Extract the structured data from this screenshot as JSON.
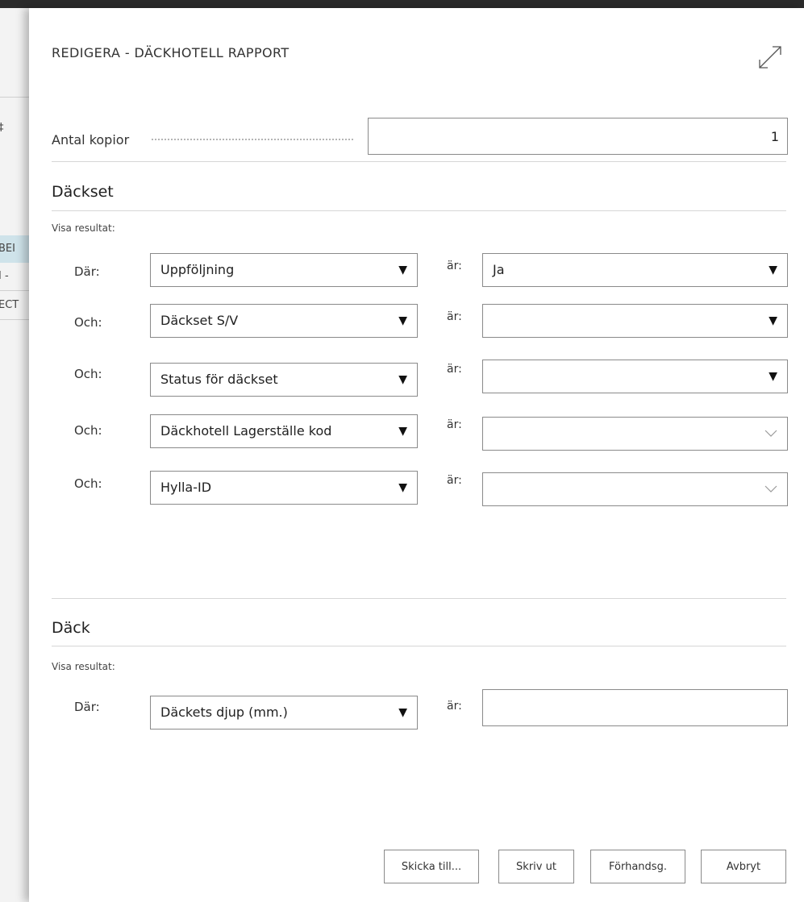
{
  "left_fragments": [
    "‡",
    "BEI",
    "I -",
    "ECT"
  ],
  "dialog": {
    "title": "REDIGERA - DÄCKHOTELL RAPPORT",
    "copies_label": "Antal kopior",
    "copies_value": "1"
  },
  "sections": [
    {
      "heading": "Däckset",
      "show_results": "Visa resultat:",
      "rows": [
        {
          "connector": "Där:",
          "field": "Uppföljning",
          "is_label": "är:",
          "value": "Ja",
          "value_control": "dropdown"
        },
        {
          "connector": "Och:",
          "field": "Däckset S/V",
          "is_label": "är:",
          "value": "",
          "value_control": "dropdown"
        },
        {
          "connector": "Och:",
          "field": "Status för däckset",
          "is_label": "är:",
          "value": "",
          "value_control": "dropdown"
        },
        {
          "connector": "Och:",
          "field": "Däckhotell Lagerställe kod",
          "is_label": "är:",
          "value": "",
          "value_control": "lookup"
        },
        {
          "connector": "Och:",
          "field": "Hylla-ID",
          "is_label": "är:",
          "value": "",
          "value_control": "lookup"
        }
      ]
    },
    {
      "heading": "Däck",
      "show_results": "Visa resultat:",
      "rows": [
        {
          "connector": "Där:",
          "field": "Däckets djup (mm.)",
          "is_label": "är:",
          "value": "",
          "value_control": "text"
        }
      ]
    }
  ],
  "buttons": {
    "send_to": "Skicka till...",
    "print": "Skriv ut",
    "preview": "Förhandsg.",
    "cancel": "Avbryt"
  },
  "icons": {
    "expand": "expand-icon",
    "dropdown_arrow": "▼",
    "lookup": "chevron-down-icon"
  }
}
